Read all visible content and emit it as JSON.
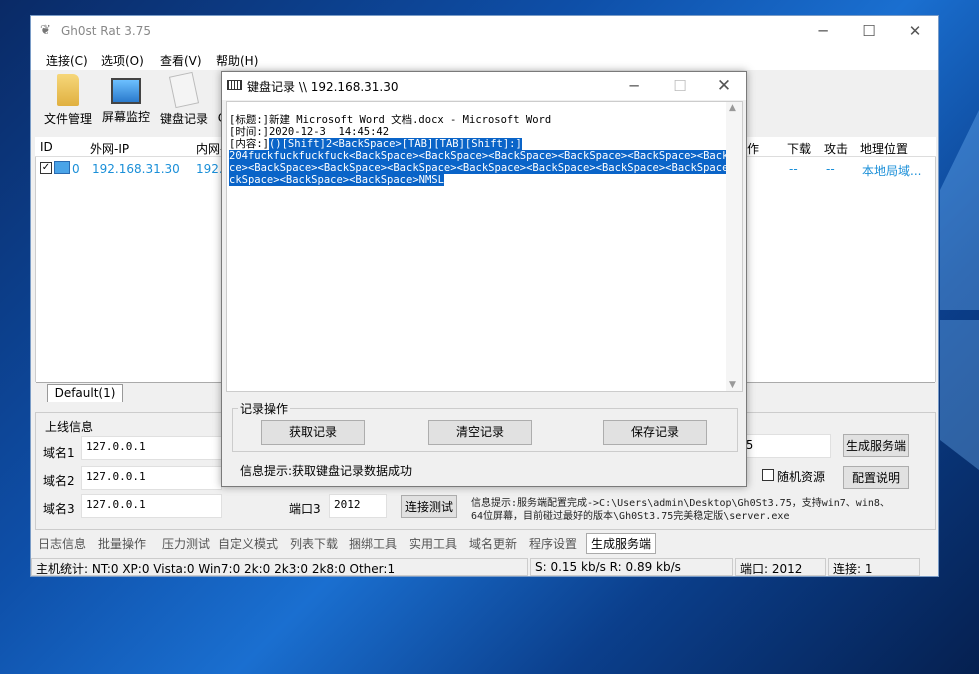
{
  "main": {
    "title": "Gh0st Rat 3.75",
    "menu": [
      "连接(C)",
      "选项(O)",
      "查看(V)",
      "帮助(H)"
    ],
    "toolbar": [
      "文件管理",
      "屏幕监控",
      "键盘记录",
      "C"
    ],
    "columns": {
      "id": "ID",
      "wan_ip": "外网-IP",
      "lan_ip": "内网-",
      "col_hidden": "作",
      "download": "下载",
      "attack": "攻击",
      "location": "地理位置"
    },
    "row": {
      "id": "0",
      "wan_ip": "192.168.31.30",
      "lan_ip": "192.",
      "download": "--",
      "attack": "--",
      "location": "本地局域..."
    },
    "group_tab": "Default(1)",
    "online_info": {
      "title": "上线信息",
      "domain1_label": "域名1",
      "domain1": "127.0.0.1",
      "domain2_label": "域名2",
      "domain2": "127.0.0.1",
      "domain3_label": "域名3",
      "domain3": "127.0.0.1",
      "port3_label": "端口3",
      "port3": "2012",
      "test_button": "连接测试",
      "right_field_tail": "5",
      "gen_button": "生成服务端",
      "random_resource": "随机资源",
      "config_button": "配置说明",
      "info_text": "信息提示:服务端配置完成->C:\\Users\\admin\\Desktop\\Gh0St3.75，支持win7、win8、64位屏幕，目前碰过最好的版本\\Gh0St3.75完美稳定版\\server.exe"
    },
    "bottom_tabs": [
      "日志信息",
      "批量操作",
      "压力测试",
      "自定义模式",
      "列表下载",
      "捆绑工具",
      "实用工具",
      "域名更新",
      "程序设置",
      "生成服务端"
    ],
    "status": {
      "hosts": "主机统计:  NT:0  XP:0  Vista:0  Win7:0  2k:0  2k3:0  2k8:0  Other:1",
      "speed": "S: 0.15 kb/s R: 0.89 kb/s",
      "port": "端口: 2012",
      "conn": "连接: 1"
    }
  },
  "dialog": {
    "title": "键盘记录 \\\\ 192.168.31.30",
    "log": {
      "line1": "[标题:]新建 Microsoft Word 文档.docx - Microsoft Word",
      "line2": "[时间:]2020-12-3  14:45:42",
      "line3a": "[内容:]",
      "line3b": "()[Shift]2<BackSpace>[TAB][TAB][Shift]:]",
      "line4": "204fuckfuckfuckfuck<BackSpace><BackSpace><BackSpace><BackSpace><BackSpace><BackSpa",
      "line5": "ce><BackSpace><BackSpace><BackSpace><BackSpace><BackSpace><BackSpace><BackSpace><Ba",
      "line6": "ckSpace><BackSpace><BackSpace>NMSL"
    },
    "group_title": "记录操作",
    "buttons": {
      "get": "获取记录",
      "clear": "清空记录",
      "save": "保存记录"
    },
    "info": "信息提示:获取键盘记录数据成功"
  }
}
